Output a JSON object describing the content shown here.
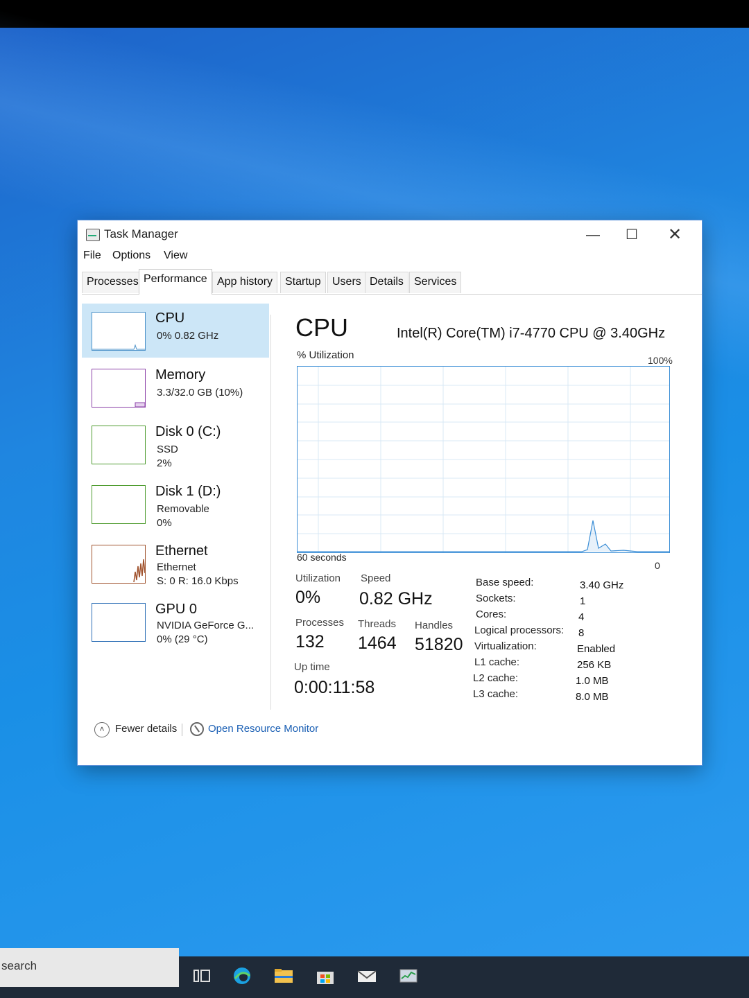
{
  "window": {
    "title": "Task Manager",
    "controls": {
      "minimize": "—",
      "maximize": "☐",
      "close": "✕"
    }
  },
  "menu": [
    "File",
    "Options",
    "View"
  ],
  "tabs": [
    "Processes",
    "Performance",
    "App history",
    "Startup",
    "Users",
    "Details",
    "Services"
  ],
  "active_tab": "Performance",
  "sidebar": {
    "items": [
      {
        "name": "CPU",
        "line1": "0% 0.82 GHz",
        "line2": ""
      },
      {
        "name": "Memory",
        "line1": "3.3/32.0 GB (10%)",
        "line2": ""
      },
      {
        "name": "Disk 0 (C:)",
        "line1": "SSD",
        "line2": "2%"
      },
      {
        "name": "Disk 1 (D:)",
        "line1": "Removable",
        "line2": "0%"
      },
      {
        "name": "Ethernet",
        "line1": "Ethernet",
        "line2": "S: 0 R: 16.0 Kbps"
      },
      {
        "name": "GPU 0",
        "line1": "NVIDIA GeForce G...",
        "line2": "0% (29 °C)"
      }
    ]
  },
  "main": {
    "title": "CPU",
    "model": "Intel(R) Core(TM) i7-4770 CPU @ 3.40GHz",
    "graph": {
      "label": "% Utilization",
      "max_label": "100%",
      "time_label": "60 seconds",
      "min_label": "0"
    },
    "stats": {
      "utilization_label": "Utilization",
      "utilization": "0%",
      "speed_label": "Speed",
      "speed": "0.82 GHz",
      "processes_label": "Processes",
      "processes": "132",
      "threads_label": "Threads",
      "threads": "1464",
      "handles_label": "Handles",
      "handles": "51820",
      "uptime_label": "Up time",
      "uptime": "0:00:11:58"
    },
    "specs": [
      {
        "label": "Base speed:",
        "value": "3.40 GHz"
      },
      {
        "label": "Sockets:",
        "value": "1"
      },
      {
        "label": "Cores:",
        "value": "4"
      },
      {
        "label": "Logical processors:",
        "value": "8"
      },
      {
        "label": "Virtualization:",
        "value": "Enabled"
      },
      {
        "label": "L1 cache:",
        "value": "256 KB"
      },
      {
        "label": "L2 cache:",
        "value": "1.0 MB"
      },
      {
        "label": "L3 cache:",
        "value": "8.0 MB"
      }
    ]
  },
  "footer": {
    "fewer_details": "Fewer details",
    "open_resource_monitor": "Open Resource Monitor"
  },
  "taskbar": {
    "search_text": "search",
    "icons": [
      "task-view-icon",
      "edge-icon",
      "file-explorer-icon",
      "store-icon",
      "mail-icon",
      "task-manager-icon"
    ]
  },
  "colors": {
    "graph_line": "#3b8ed6",
    "selected_bg": "#cce6f7",
    "link": "#1a5fb4"
  }
}
